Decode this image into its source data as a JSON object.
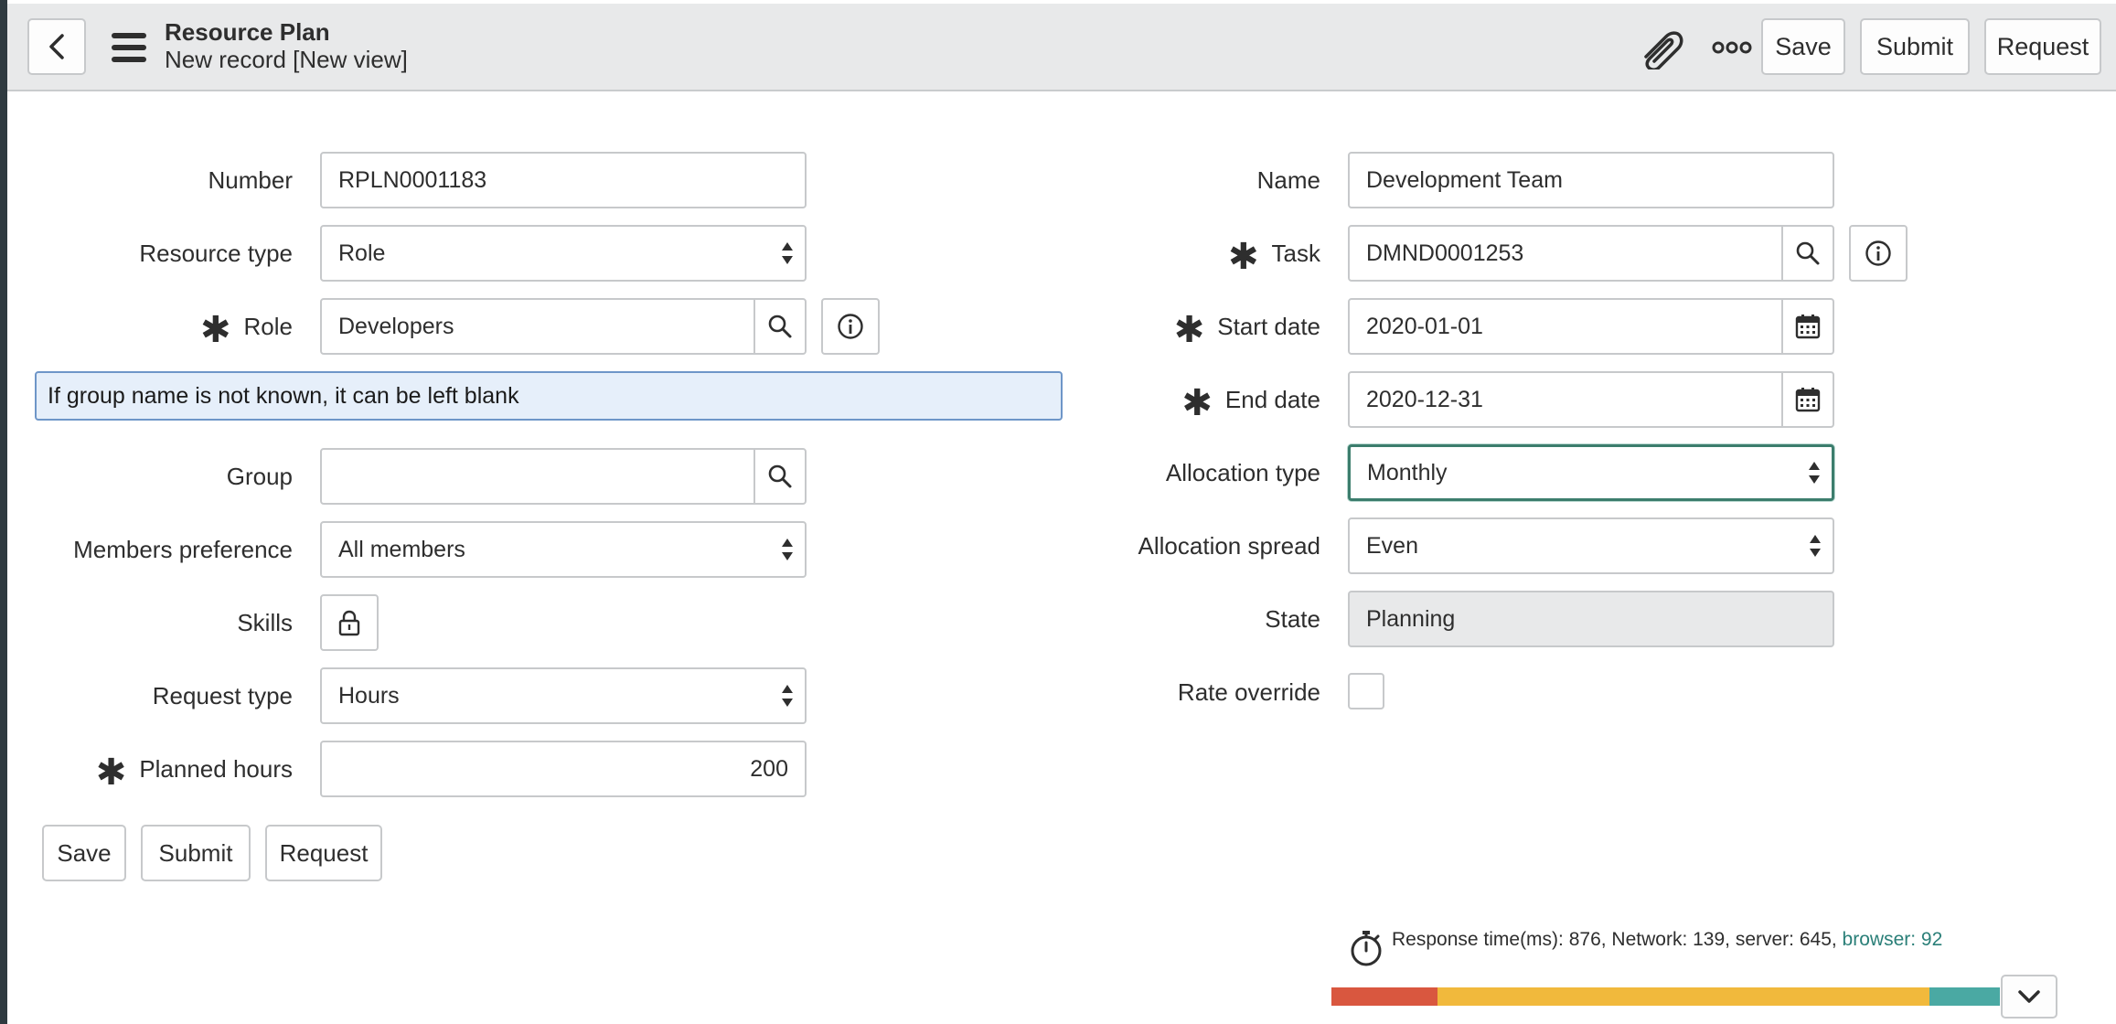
{
  "header": {
    "title": "Resource Plan",
    "subtitle": "New record [New view]",
    "save_label": "Save",
    "submit_label": "Submit",
    "request_label": "Request"
  },
  "form": {
    "number": {
      "label": "Number",
      "value": "RPLN0001183"
    },
    "resource_type": {
      "label": "Resource type",
      "value": "Role"
    },
    "role": {
      "label": "Role",
      "value": "Developers",
      "required": true
    },
    "hint": "If group name is not known, it can be left blank",
    "group": {
      "label": "Group",
      "value": ""
    },
    "members_preference": {
      "label": "Members preference",
      "value": "All members"
    },
    "skills": {
      "label": "Skills"
    },
    "request_type": {
      "label": "Request type",
      "value": "Hours"
    },
    "planned_hours": {
      "label": "Planned hours",
      "value": "200",
      "required": true
    },
    "name": {
      "label": "Name",
      "value": "Development Team"
    },
    "task": {
      "label": "Task",
      "value": "DMND0001253",
      "required": true
    },
    "start_date": {
      "label": "Start date",
      "value": "2020-01-01",
      "required": true
    },
    "end_date": {
      "label": "End date",
      "value": "2020-12-31",
      "required": true
    },
    "allocation_type": {
      "label": "Allocation type",
      "value": "Monthly"
    },
    "allocation_spread": {
      "label": "Allocation spread",
      "value": "Even"
    },
    "state": {
      "label": "State",
      "value": "Planning"
    },
    "rate_override": {
      "label": "Rate override",
      "checked": false
    }
  },
  "footer_buttons": {
    "save_label": "Save",
    "submit_label": "Submit",
    "request_label": "Request"
  },
  "response": {
    "text": "Response time(ms): 876, Network: 139, server: 645, ",
    "browser": "browser: 92",
    "network_ms": 139,
    "server_ms": 645,
    "browser_ms": 92,
    "colors": {
      "network": "#d9573f",
      "server": "#f1b93c",
      "browser": "#4aa9a3"
    }
  },
  "icons": {
    "back": "chevron-left-icon",
    "menu": "hamburger-icon",
    "attach": "paperclip-icon",
    "more": "more-icon",
    "search": "magnifier-icon",
    "info": "info-icon",
    "calendar": "calendar-icon",
    "lock": "lock-icon",
    "timer": "stopwatch-icon",
    "expand": "chevron-down-icon"
  }
}
